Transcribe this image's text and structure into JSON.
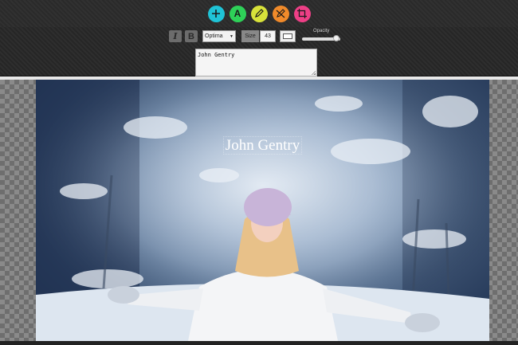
{
  "toolbar": {
    "tools": [
      {
        "id": "add",
        "icon": "plus-icon",
        "color": "#1fc3d6"
      },
      {
        "id": "text",
        "icon": "text-a-icon",
        "color": "#2ed158",
        "glyph": "A"
      },
      {
        "id": "draw",
        "icon": "pencil-icon",
        "color": "#d8e23a"
      },
      {
        "id": "erase",
        "icon": "no-draw-icon",
        "color": "#f08a2a"
      },
      {
        "id": "crop",
        "icon": "crop-icon",
        "color": "#ee3f86"
      }
    ]
  },
  "text_options": {
    "italic_label": "I",
    "bold_label": "B",
    "font_value": "Optima",
    "size_label": "Size",
    "size_value": "43",
    "color": "#ffffff",
    "opacity_label": "Opacity",
    "opacity": 0.9,
    "text_value": "John Gentry"
  },
  "canvas": {
    "overlay_text": "John Gentry"
  }
}
